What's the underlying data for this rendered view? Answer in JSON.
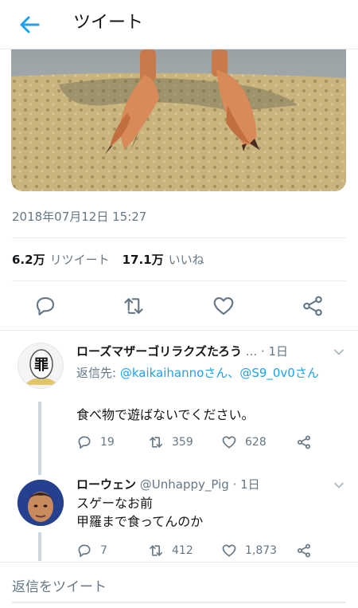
{
  "header": {
    "title": "ツイート"
  },
  "tweet": {
    "timestamp": "2018年07月12日 15:27",
    "retweets": {
      "count": "6.2万",
      "label": "リツイート"
    },
    "likes": {
      "count": "17.1万",
      "label": "いいね"
    }
  },
  "replies": [
    {
      "name": "ローズマザーゴリラクズたろう",
      "ellipsis": "...",
      "time": "1日",
      "reply_prefix": "返信先: ",
      "mention1": "@kaikaihanno",
      "san1": "さん、",
      "mention2": "@S9_0v0",
      "san2": "さん",
      "text": "食べ物で遊ばないでください。",
      "counts": {
        "reply": "19",
        "retweet": "359",
        "like": "628"
      }
    },
    {
      "name": "ローウェン",
      "handle": "@Unhappy_Pig · 1日",
      "text": "スゲーなお前\n甲羅まで食ってんのか",
      "counts": {
        "reply": "7",
        "retweet": "412",
        "like": "1,873"
      }
    }
  ],
  "compose": {
    "placeholder": "返信をツイート"
  },
  "colors": {
    "accent": "#1da1f2",
    "muted": "#657786",
    "divider": "#e6ecf0"
  }
}
